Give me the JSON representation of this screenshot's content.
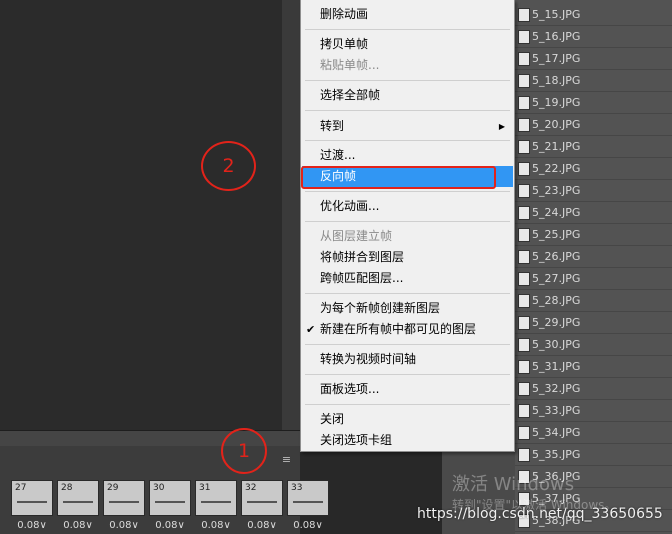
{
  "menu": {
    "items": [
      {
        "label": "删除动画",
        "enabled": true
      },
      {
        "label": "拷贝单帧",
        "enabled": true
      },
      {
        "label": "粘贴单帧...",
        "enabled": false
      },
      {
        "label": "选择全部帧",
        "enabled": true
      },
      {
        "label": "转到",
        "enabled": true,
        "submenu": true
      },
      {
        "label": "过渡...",
        "enabled": true
      },
      {
        "label": "反向帧",
        "enabled": true,
        "highlighted": true
      },
      {
        "label": "优化动画...",
        "enabled": true
      },
      {
        "label": "从图层建立帧",
        "enabled": false
      },
      {
        "label": "将帧拼合到图层",
        "enabled": true
      },
      {
        "label": "跨帧匹配图层...",
        "enabled": true
      },
      {
        "label": "为每个新帧创建新图层",
        "enabled": true
      },
      {
        "label": "新建在所有帧中都可见的图层",
        "enabled": true,
        "checked": true
      },
      {
        "label": "转换为视频时间轴",
        "enabled": true
      },
      {
        "label": "面板选项...",
        "enabled": true
      },
      {
        "label": "关闭",
        "enabled": true
      },
      {
        "label": "关闭选项卡组",
        "enabled": true
      }
    ],
    "submenu_arrow": "▶",
    "check_mark": "✔"
  },
  "layers": [
    "5_15.JPG",
    "5_16.JPG",
    "5_17.JPG",
    "5_18.JPG",
    "5_19.JPG",
    "5_20.JPG",
    "5_21.JPG",
    "5_22.JPG",
    "5_23.JPG",
    "5_24.JPG",
    "5_25.JPG",
    "5_26.JPG",
    "5_27.JPG",
    "5_28.JPG",
    "5_29.JPG",
    "5_30.JPG",
    "5_31.JPG",
    "5_32.JPG",
    "5_33.JPG",
    "5_34.JPG",
    "5_35.JPG",
    "5_36.JPG",
    "5_37.JPG",
    "5_38.JPG"
  ],
  "frames": [
    {
      "number": "27",
      "delay": "0.08"
    },
    {
      "number": "28",
      "delay": "0.08"
    },
    {
      "number": "29",
      "delay": "0.08"
    },
    {
      "number": "30",
      "delay": "0.08"
    },
    {
      "number": "31",
      "delay": "0.08"
    },
    {
      "number": "32",
      "delay": "0.08"
    },
    {
      "number": "33",
      "delay": "0.08"
    }
  ],
  "frame_delay_arrow": "∨",
  "annotations": {
    "circle_1": "1",
    "circle_2": "2"
  },
  "watermark": {
    "line1": "激活 Windows",
    "line2": "转到\"设置\"以激活 Windows。"
  },
  "url": "https://blog.csdn.net/qq_33650655",
  "panel_menu_icon": "≡",
  "colors": {
    "highlight": "#3196f3",
    "annotation": "#e2231a",
    "menu_bg": "#f0f0f0"
  }
}
